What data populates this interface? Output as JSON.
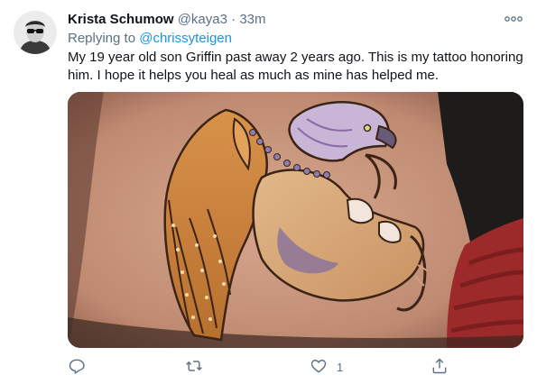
{
  "tweet": {
    "display_name": "Krista Schumow",
    "handle": "@kaya3",
    "separator": "·",
    "time": "33m",
    "replying_prefix": "Replying to",
    "replying_to": "@chrissyteigen",
    "text": "My 19 year old son Griffin past away 2 years ago.  This is my tattoo honoring him. I hope it helps you heal as much as mine has helped me."
  },
  "media": {
    "subject": "tattoo-photo-griffin"
  },
  "actions": {
    "reply_icon": "reply-icon",
    "retweet_icon": "retweet-icon",
    "like_icon": "heart-icon",
    "like_count": "1",
    "share_icon": "share-icon"
  },
  "colors": {
    "primary_text": "#0f1419",
    "secondary_text": "#5b7083",
    "link": "#1b95e0"
  }
}
